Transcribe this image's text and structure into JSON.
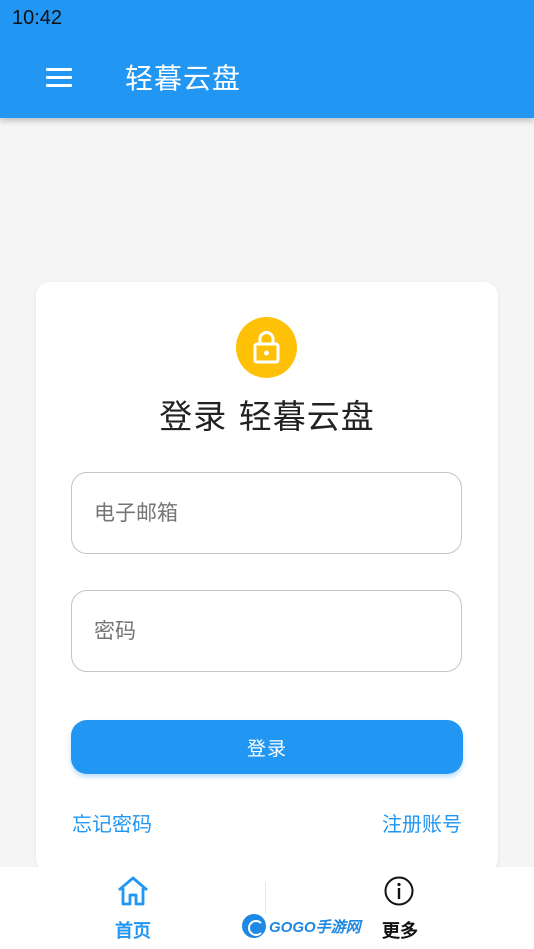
{
  "status_bar": {
    "time": "10:42"
  },
  "app_bar": {
    "title": "轻暮云盘",
    "menu_icon": "hamburger-menu-icon"
  },
  "login_card": {
    "icon": "lock-icon",
    "icon_color": "#ffc107",
    "title": "登录 轻暮云盘",
    "email": {
      "placeholder": "电子邮箱",
      "value": ""
    },
    "password": {
      "placeholder": "密码",
      "value": ""
    },
    "login_button": "登录",
    "forgot_password": "忘记密码",
    "register": "注册账号"
  },
  "bottom_nav": {
    "items": [
      {
        "label": "首页",
        "icon": "home-icon",
        "active": true
      },
      {
        "label": "更多",
        "icon": "info-icon",
        "active": false
      }
    ]
  },
  "watermark": {
    "text": "GOGO手游网"
  },
  "colors": {
    "primary": "#2196f3",
    "accent": "#ffc107",
    "background": "#f5f5f5"
  }
}
